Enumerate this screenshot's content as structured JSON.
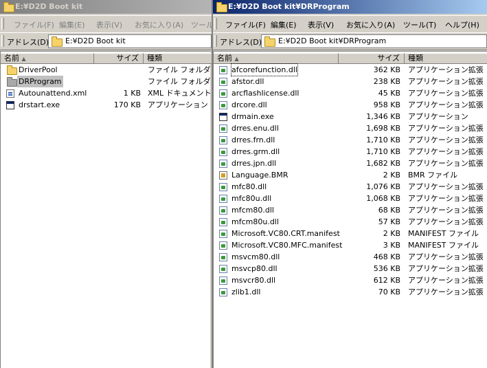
{
  "left_window": {
    "title": "E:¥D2D Boot kit",
    "menu": [
      "ファイル(F)",
      "編集(E)",
      "表示(V)",
      "お気に入り(A)",
      "ツール"
    ],
    "address_label": "アドレス(D)",
    "address_value": "E:¥D2D Boot kit",
    "columns": {
      "name": "名前",
      "size": "サイズ",
      "type": "種類"
    },
    "files": [
      {
        "name": "DriverPool",
        "size": "",
        "type": "ファイル フォルダ",
        "icon": "folder-icon"
      },
      {
        "name": "DRProgram",
        "size": "",
        "type": "ファイル フォルダ",
        "icon": "folder-icon",
        "selected": true
      },
      {
        "name": "Autounattend.xml",
        "size": "1 KB",
        "type": "XML ドキュメント",
        "icon": "xml-file-icon"
      },
      {
        "name": "drstart.exe",
        "size": "170 KB",
        "type": "アプリケーション",
        "icon": "exe-icon"
      }
    ]
  },
  "right_window": {
    "title": "E:¥D2D Boot kit¥DRProgram",
    "menu": [
      "ファイル(F)",
      "編集(E)",
      "表示(V)",
      "お気に入り(A)",
      "ツール(T)",
      "ヘルプ(H)"
    ],
    "address_label": "アドレス(D)",
    "address_value": "E:¥D2D Boot kit¥DRProgram",
    "columns": {
      "name": "名前",
      "size": "サイズ",
      "type": "種類"
    },
    "files": [
      {
        "name": "afcorefunction.dll",
        "size": "362 KB",
        "type": "アプリケーション拡張",
        "icon": "dll-icon",
        "focused": true
      },
      {
        "name": "afstor.dll",
        "size": "238 KB",
        "type": "アプリケーション拡張",
        "icon": "dll-icon"
      },
      {
        "name": "arcflashlicense.dll",
        "size": "45 KB",
        "type": "アプリケーション拡張",
        "icon": "dll-icon"
      },
      {
        "name": "drcore.dll",
        "size": "958 KB",
        "type": "アプリケーション拡張",
        "icon": "dll-icon"
      },
      {
        "name": "drmain.exe",
        "size": "1,346 KB",
        "type": "アプリケーション",
        "icon": "exe-icon"
      },
      {
        "name": "drres.enu.dll",
        "size": "1,698 KB",
        "type": "アプリケーション拡張",
        "icon": "dll-icon"
      },
      {
        "name": "drres.frn.dll",
        "size": "1,710 KB",
        "type": "アプリケーション拡張",
        "icon": "dll-icon"
      },
      {
        "name": "drres.grm.dll",
        "size": "1,710 KB",
        "type": "アプリケーション拡張",
        "icon": "dll-icon"
      },
      {
        "name": "drres.jpn.dll",
        "size": "1,682 KB",
        "type": "アプリケーション拡張",
        "icon": "dll-icon"
      },
      {
        "name": "Language.BMR",
        "size": "2 KB",
        "type": "BMR ファイル",
        "icon": "bmr-file-icon"
      },
      {
        "name": "mfc80.dll",
        "size": "1,076 KB",
        "type": "アプリケーション拡張",
        "icon": "dll-icon"
      },
      {
        "name": "mfc80u.dll",
        "size": "1,068 KB",
        "type": "アプリケーション拡張",
        "icon": "dll-icon"
      },
      {
        "name": "mfcm80.dll",
        "size": "68 KB",
        "type": "アプリケーション拡張",
        "icon": "dll-icon"
      },
      {
        "name": "mfcm80u.dll",
        "size": "57 KB",
        "type": "アプリケーション拡張",
        "icon": "dll-icon"
      },
      {
        "name": "Microsoft.VC80.CRT.manifest",
        "size": "2 KB",
        "type": "MANIFEST ファイル",
        "icon": "manifest-icon"
      },
      {
        "name": "Microsoft.VC80.MFC.manifest",
        "size": "3 KB",
        "type": "MANIFEST ファイル",
        "icon": "manifest-icon"
      },
      {
        "name": "msvcm80.dll",
        "size": "468 KB",
        "type": "アプリケーション拡張",
        "icon": "dll-icon"
      },
      {
        "name": "msvcp80.dll",
        "size": "536 KB",
        "type": "アプリケーション拡張",
        "icon": "dll-icon"
      },
      {
        "name": "msvcr80.dll",
        "size": "612 KB",
        "type": "アプリケーション拡張",
        "icon": "dll-icon"
      },
      {
        "name": "zlib1.dll",
        "size": "70 KB",
        "type": "アプリケーション拡張",
        "icon": "dll-icon"
      }
    ]
  },
  "colors": {
    "active_title": "#0a246a",
    "inactive_title": "#808080",
    "window_face": "#d4d0c8",
    "selection_inactive": "#c0c0c0"
  }
}
